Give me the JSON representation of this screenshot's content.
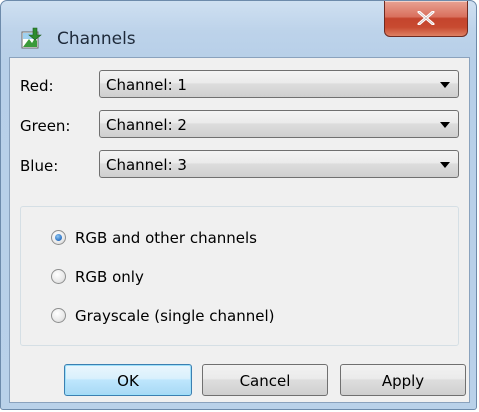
{
  "window": {
    "title": "Channels",
    "close_glyph": "X"
  },
  "channels": [
    {
      "label": "Red:",
      "value": "Channel: 1"
    },
    {
      "label": "Green:",
      "value": "Channel: 2"
    },
    {
      "label": "Blue:",
      "value": "Channel: 3"
    }
  ],
  "mode": {
    "options": [
      {
        "label": "RGB and other channels",
        "selected": true
      },
      {
        "label": "RGB only",
        "selected": false
      },
      {
        "label": "Grayscale (single channel)",
        "selected": false
      }
    ]
  },
  "buttons": {
    "ok": "OK",
    "cancel": "Cancel",
    "apply": "Apply"
  },
  "icons": {
    "app": "channels-app-icon",
    "close": "close-icon",
    "dropdown": "chevron-down-icon"
  },
  "colors": {
    "accent": "#3c7fb1",
    "close_button": "#c4442d",
    "radio_selected": "#2a70c2"
  }
}
